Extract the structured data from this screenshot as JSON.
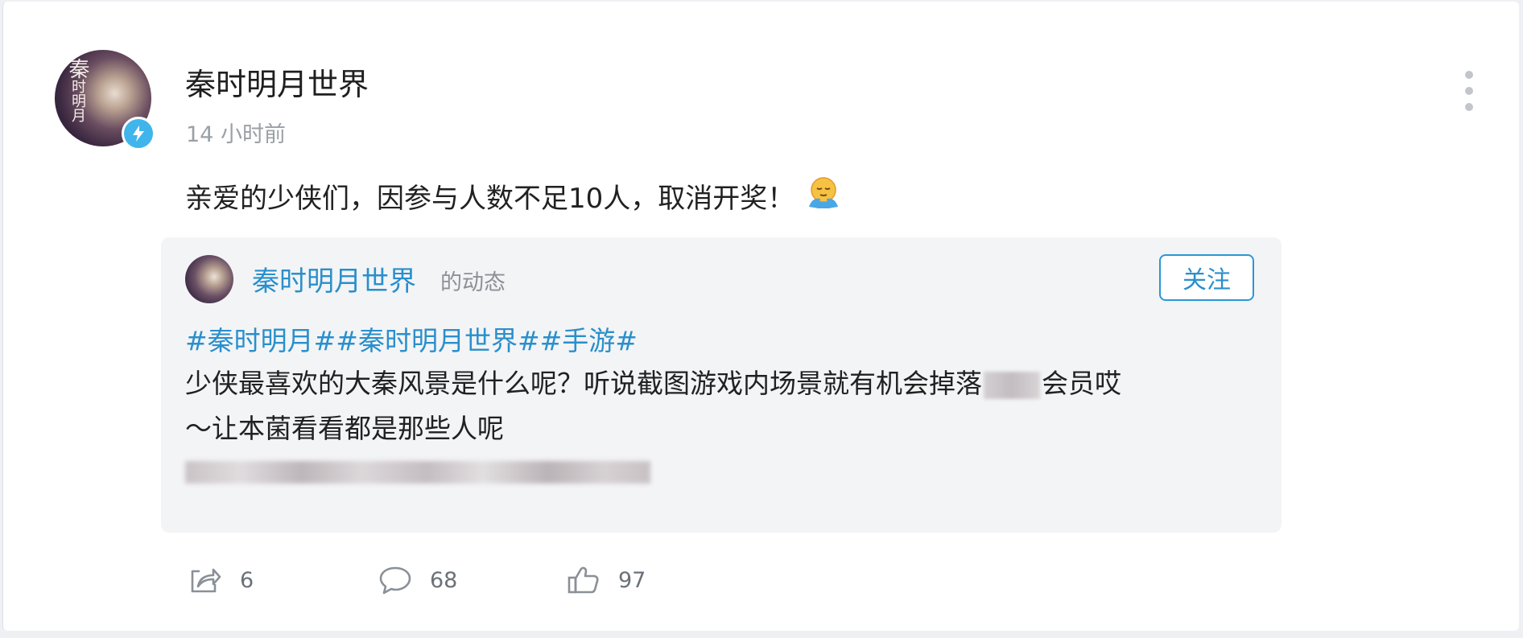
{
  "post": {
    "author": "秦时明月世界",
    "time": "14 小时前",
    "text": "亲爱的少侠们，因参与人数不足10人，取消开奖！",
    "avatar_seal_big": "秦",
    "avatar_seal_small": "时明月"
  },
  "repost": {
    "author": "秦时明月世界",
    "suffix": "的动态",
    "follow_label": "关注",
    "tags": "#秦时明月##秦时明月世界##手游#",
    "body_line1_a": "少侠最喜欢的大秦风景是什么呢？听说截图游戏内场景就有机会掉落",
    "body_line1_b": "会员哎",
    "body_line2": "～让本菌看看都是那些人呢"
  },
  "actions": {
    "share_count": "6",
    "comment_count": "68",
    "like_count": "97"
  },
  "icons": {
    "more": "more-vertical-icon",
    "badge": "lightning-icon",
    "emoji": "hug-emoji-icon",
    "share": "share-icon",
    "comment": "comment-icon",
    "like": "thumbs-up-icon"
  },
  "colors": {
    "link": "#2a8fcc",
    "badge": "#3fb5ec",
    "repost_bg": "#f3f4f6",
    "muted": "#9aa0a6"
  }
}
